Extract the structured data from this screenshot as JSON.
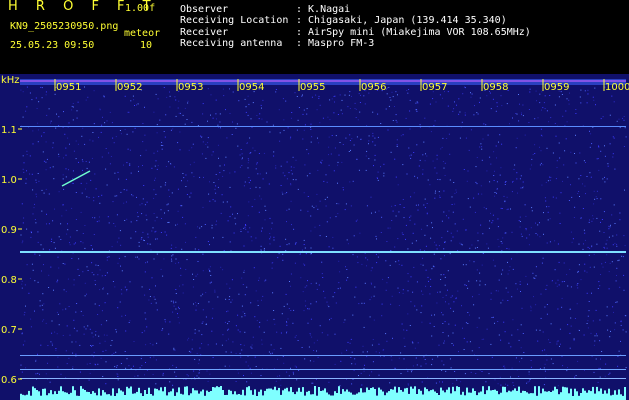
{
  "header": {
    "app_name": "H R O F F T",
    "version": "1.00f",
    "filename": "KN9_2505230950.png",
    "timestamp": "25.05.23 09:50",
    "label_meteor": "meteor",
    "meteor_count": "10",
    "fields": [
      {
        "label": "Observer",
        "value": ": K.Nagai"
      },
      {
        "label": "Receiving Location",
        "value": ": Chigasaki, Japan (139.414 35.340)"
      },
      {
        "label": "Receiver",
        "value": ": AirSpy mini (Miakejima VOR 108.65MHz)"
      },
      {
        "label": "Receiving antenna",
        "value": ": Maspro FM-3"
      }
    ]
  },
  "spectrogram": {
    "y_unit": "kHz",
    "y_ticks": [
      "1.1",
      "1.0",
      "0.9",
      "0.8",
      "0.7",
      "0.6"
    ],
    "time_ticks": [
      "0951",
      "0952",
      "0953",
      "0954",
      "0955",
      "0956",
      "0957",
      "0958",
      "0959",
      "1000"
    ],
    "background_color": "#10106a",
    "noise_color": "#3a3aff",
    "signal_color": "#7fffff",
    "text_color": "#ffff33"
  }
}
